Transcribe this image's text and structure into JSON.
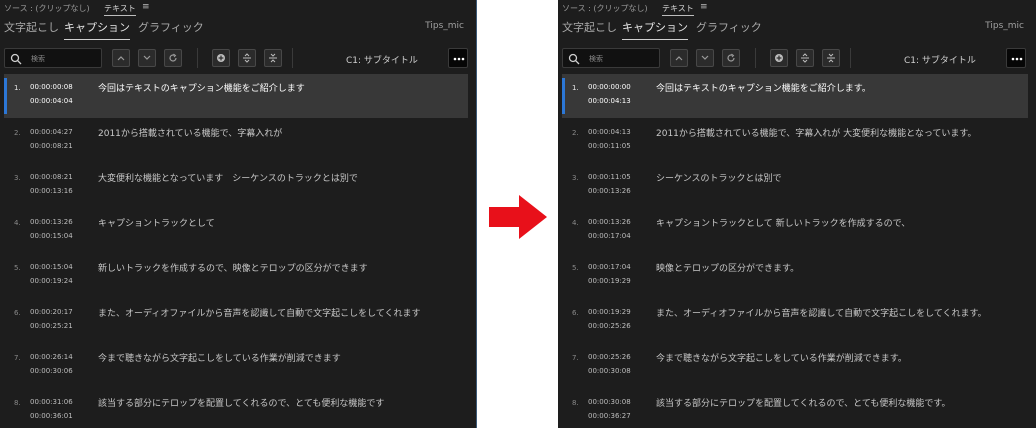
{
  "left": {
    "source": "ソース : (クリップなし)",
    "text_tab": "テキスト",
    "menu_icon": "≡",
    "tabs": [
      "文字起こし",
      "キャプション",
      "グラフィック"
    ],
    "mic": "Tips_mic",
    "search_placeholder": "検索",
    "track": "C1: サブタイトル",
    "rows": [
      {
        "n": "1.",
        "in": "00:00:00:08",
        "out": "00:00:04:04",
        "text": "今回はテキストのキャプション機能をご紹介します"
      },
      {
        "n": "2.",
        "in": "00:00:04:27",
        "out": "00:00:08:21",
        "text": "2011から搭載されている機能で、字幕入れが"
      },
      {
        "n": "3.",
        "in": "00:00:08:21",
        "out": "00:00:13:16",
        "text": "大変便利な機能となっています　シーケンスのトラックとは別で"
      },
      {
        "n": "4.",
        "in": "00:00:13:26",
        "out": "00:00:15:04",
        "text": "キャプショントラックとして"
      },
      {
        "n": "5.",
        "in": "00:00:15:04",
        "out": "00:00:19:24",
        "text": "新しいトラックを作成するので、映像とテロップの区分ができます"
      },
      {
        "n": "6.",
        "in": "00:00:20:17",
        "out": "00:00:25:21",
        "text": "また、オーディオファイルから音声を認識して自動で文字起こしをしてくれます"
      },
      {
        "n": "7.",
        "in": "00:00:26:14",
        "out": "00:00:30:06",
        "text": "今まで聴きながら文字起こしをしている作業が削減できます"
      },
      {
        "n": "8.",
        "in": "00:00:31:06",
        "out": "00:00:36:01",
        "text": "該当する部分にテロップを配置してくれるので、とても便利な機能です"
      }
    ]
  },
  "right": {
    "source": "ソース : (クリップなし)",
    "text_tab": "テキスト",
    "menu_icon": "≡",
    "tabs": [
      "文字起こし",
      "キャプション",
      "グラフィック"
    ],
    "mic": "Tips_mic",
    "search_placeholder": "検索",
    "track": "C1: サブタイトル",
    "rows": [
      {
        "n": "1.",
        "in": "00:00:00:00",
        "out": "00:00:04:13",
        "text": "今回はテキストのキャプション機能をご紹介します。"
      },
      {
        "n": "2.",
        "in": "00:00:04:13",
        "out": "00:00:11:05",
        "text": "2011から搭載されている機能で、字幕入れが 大変便利な機能となっています。"
      },
      {
        "n": "3.",
        "in": "00:00:11:05",
        "out": "00:00:13:26",
        "text": "シーケンスのトラックとは別で"
      },
      {
        "n": "4.",
        "in": "00:00:13:26",
        "out": "00:00:17:04",
        "text": "キャプショントラックとして 新しいトラックを作成するので、"
      },
      {
        "n": "5.",
        "in": "00:00:17:04",
        "out": "00:00:19:29",
        "text": "映像とテロップの区分ができます。"
      },
      {
        "n": "6.",
        "in": "00:00:19:29",
        "out": "00:00:25:26",
        "text": "また、オーディオファイルから音声を認識して自動で文字起こしをしてくれます。"
      },
      {
        "n": "7.",
        "in": "00:00:25:26",
        "out": "00:00:30:08",
        "text": "今まで聴きながら文字起こしをしている作業が削減できます。"
      },
      {
        "n": "8.",
        "in": "00:00:30:08",
        "out": "00:00:36:27",
        "text": "該当する部分にテロップを配置してくれるので、とても便利な機能です。"
      }
    ]
  },
  "colors": {
    "arrow": "#e8101a",
    "selection_accent": "#2c77d6",
    "panel_bg": "#1d1d1d"
  }
}
